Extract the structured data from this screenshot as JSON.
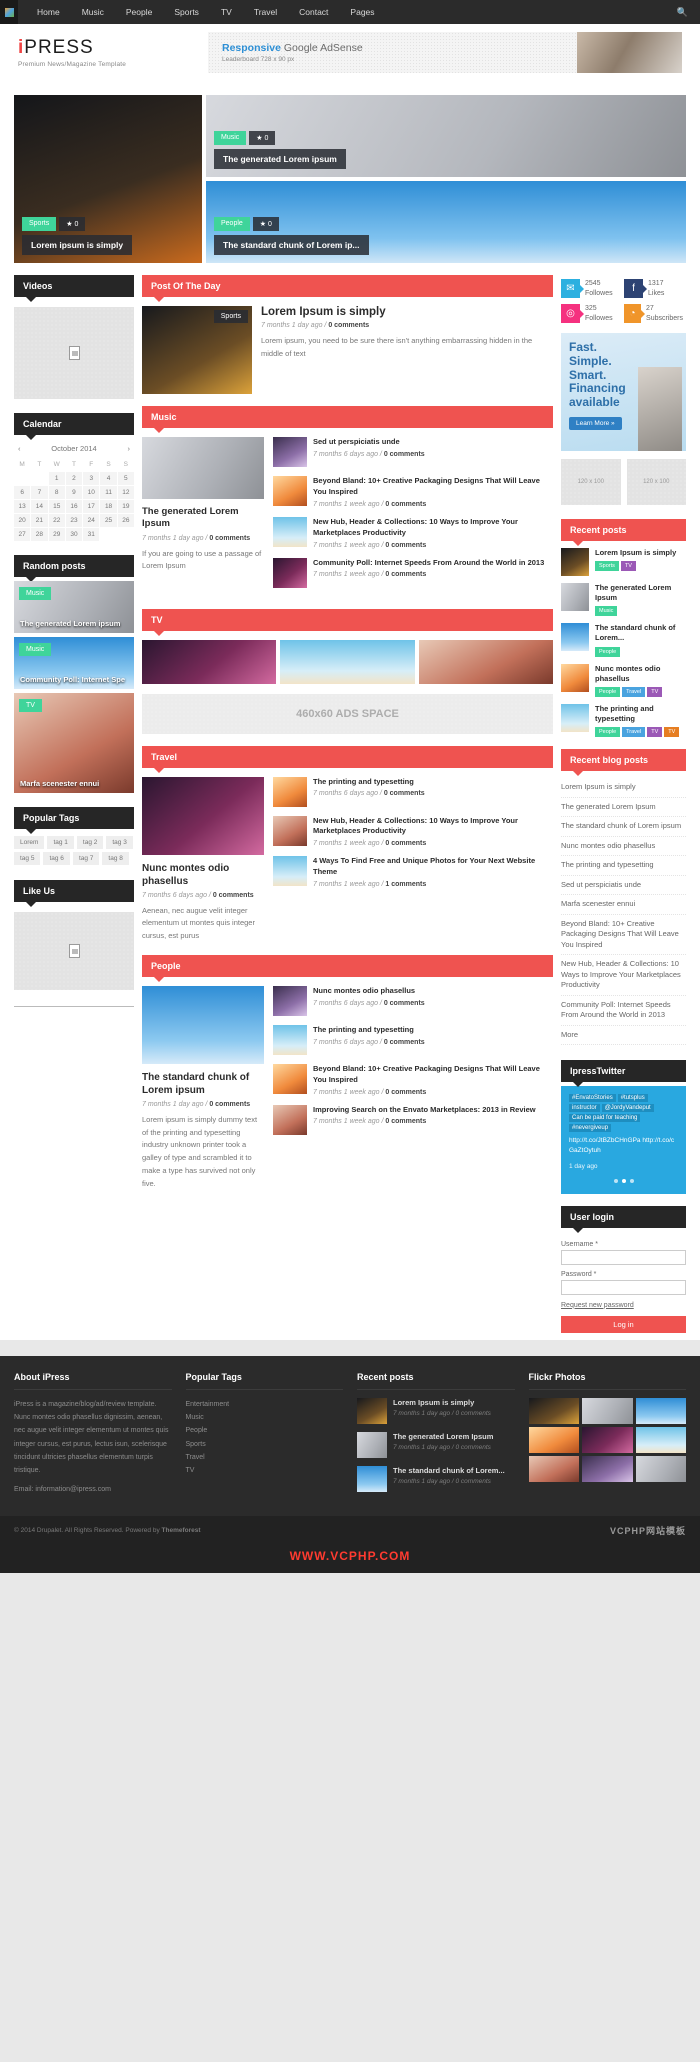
{
  "topnav": {
    "items": [
      "Home",
      "Music",
      "People",
      "Sports",
      "TV",
      "Travel",
      "Contact",
      "Pages"
    ],
    "search_icon": "search-icon"
  },
  "header": {
    "logo_i": "i",
    "logo_rest": "PRESS",
    "tagline": "Premium News/Magazine Template",
    "ad_line1_bold": "Responsive",
    "ad_line1_rest": " Google AdSense",
    "ad_line2": "Leaderboard 728 x 90 px"
  },
  "slider": {
    "big": {
      "category": "Sports",
      "stars": "0",
      "title": "Lorem ipsum is simply"
    },
    "small1": {
      "category": "Music",
      "stars": "0",
      "title": "The generated Lorem ipsum"
    },
    "small2": {
      "category": "People",
      "stars": "0",
      "title": "The standard chunk of Lorem ip..."
    }
  },
  "left": {
    "videos_title": "Videos",
    "calendar_title": "Calendar",
    "calendar": {
      "prev": "‹",
      "next": "›",
      "month": "October 2014",
      "weekdays": [
        "M",
        "T",
        "W",
        "T",
        "F",
        "S",
        "S"
      ],
      "lead_blanks": 2,
      "days": [
        1,
        2,
        3,
        4,
        5,
        6,
        7,
        8,
        9,
        10,
        11,
        12,
        13,
        14,
        15,
        16,
        17,
        18,
        19,
        20,
        21,
        22,
        23,
        24,
        25,
        26,
        27,
        28,
        29,
        30,
        31
      ]
    },
    "random_title": "Random posts",
    "random": [
      {
        "tag": "Music",
        "title": "The generated Lorem ipsum"
      },
      {
        "tag": "Music",
        "title": "Community Poll: Internet Spe"
      },
      {
        "tag": "TV",
        "title": "Marfa scenester ennui"
      }
    ],
    "tags_title": "Popular Tags",
    "tags": [
      "Lorem",
      "tag 1",
      "tag 2",
      "tag 3",
      "tag 5",
      "tag 6",
      "tag 7",
      "tag 8"
    ],
    "like_title": "Like Us"
  },
  "mid": {
    "pod_title": "Post Of The Day",
    "pod": {
      "badge": "Sports",
      "title": "Lorem Ipsum is simply",
      "meta": "7 months 1 day ago / ",
      "meta_b": "0 comments",
      "excerpt": "Lorem ipsum, you need to be sure there isn't anything embarrassing hidden in the middle of text"
    },
    "music_title": "Music",
    "music_main": {
      "title": "The generated Lorem Ipsum",
      "meta": "7 months 1 day ago / ",
      "meta_b": "0 comments",
      "excerpt": "If you are going to use a passage of Lorem Ipsum"
    },
    "music_list": [
      {
        "title": "Sed ut perspiciatis unde",
        "meta": "7 months 6 days ago / ",
        "meta_b": "0 comments"
      },
      {
        "title": "Beyond Bland: 10+ Creative Packaging Designs That Will Leave You Inspired",
        "meta": "7 months 1 week ago / ",
        "meta_b": "0 comments"
      },
      {
        "title": "New Hub, Header & Collections: 10 Ways to Improve Your Marketplaces Productivity",
        "meta": "7 months 1 week ago / ",
        "meta_b": "0 comments"
      },
      {
        "title": "Community Poll: Internet Speeds From Around the World in 2013",
        "meta": "7 months 1 week ago / ",
        "meta_b": "0 comments"
      }
    ],
    "tv_title": "TV",
    "ads_label": "460x60 ADS SPACE",
    "travel_title": "Travel",
    "travel_main": {
      "title": "Nunc montes odio phasellus",
      "meta": "7 months 6 days ago / ",
      "meta_b": "0 comments",
      "excerpt": "Aenean, nec augue velit integer elementum ut montes quis integer cursus, est purus"
    },
    "travel_list": [
      {
        "title": "The printing and typesetting",
        "meta": "7 months 6 days ago / ",
        "meta_b": "0 comments"
      },
      {
        "title": "New Hub, Header & Collections: 10 Ways to Improve Your Marketplaces Productivity",
        "meta": "7 months 1 week ago / ",
        "meta_b": "0 comments"
      },
      {
        "title": "4 Ways To Find Free and Unique Photos for Your Next Website Theme",
        "meta": "7 months 1 week ago / ",
        "meta_b": "1 comments"
      }
    ],
    "people_title": "People",
    "people_main": {
      "title": "The standard chunk of Lorem ipsum",
      "meta": "7 months 1 day ago / ",
      "meta_b": "0 comments",
      "excerpt": "Lorem ipsum is simply dummy text of the printing and typesetting industry unknown printer took a galley of type and scrambled it to make a type has survived not only five."
    },
    "people_list": [
      {
        "title": "Nunc montes odio phasellus",
        "meta": "7 months 6 days ago / ",
        "meta_b": "0 comments"
      },
      {
        "title": "The printing and typesetting",
        "meta": "7 months 6 days ago / ",
        "meta_b": "0 comments"
      },
      {
        "title": "Beyond Bland: 10+ Creative Packaging Designs That Will Leave You Inspired",
        "meta": "7 months 1 week ago / ",
        "meta_b": "0 comments"
      },
      {
        "title": "Improving Search on the Envato Marketplaces: 2013 in Review",
        "meta": "7 months 1 week ago / ",
        "meta_b": "0 comments"
      }
    ]
  },
  "right": {
    "social": [
      {
        "icon": "twitter-icon",
        "count": "2545",
        "label": "Followes",
        "color": "#2cb0e0"
      },
      {
        "icon": "facebook-icon",
        "count": "1317",
        "label": "Likes",
        "color": "#2d4373"
      },
      {
        "icon": "dribbble-icon",
        "count": "325",
        "label": "Followes",
        "color": "#f5317f"
      },
      {
        "icon": "rss-icon",
        "count": "27",
        "label": "Subscribers",
        "color": "#f0952a"
      }
    ],
    "banner": {
      "l1": "Fast.",
      "l2": "Simple.",
      "l3": "Smart.",
      "l4": "Financing",
      "l5": "available",
      "cta": "Learn More »"
    },
    "placeholders": [
      "120 x 100",
      "120 x 100"
    ],
    "recent_title": "Recent posts",
    "recent": [
      {
        "title": "Lorem Ipsum is simply",
        "tags": [
          {
            "t": "Sports",
            "c": "#3fd49a"
          },
          {
            "t": "TV",
            "c": "#9b59b6"
          }
        ]
      },
      {
        "title": "The generated Lorem Ipsum",
        "tags": [
          {
            "t": "Music",
            "c": "#3fd49a"
          }
        ]
      },
      {
        "title": "The standard chunk of Lorem...",
        "tags": [
          {
            "t": "People",
            "c": "#3fd49a"
          }
        ]
      },
      {
        "title": "Nunc montes odio phasellus",
        "tags": [
          {
            "t": "People",
            "c": "#3fd49a"
          },
          {
            "t": "Travel",
            "c": "#4aa3df"
          },
          {
            "t": "TV",
            "c": "#9b59b6"
          }
        ]
      },
      {
        "title": "The printing and typesetting",
        "tags": [
          {
            "t": "People",
            "c": "#3fd49a"
          },
          {
            "t": "Travel",
            "c": "#4aa3df"
          },
          {
            "t": "TV",
            "c": "#9b59b6"
          },
          {
            "t": "TV",
            "c": "#e67e22"
          }
        ]
      }
    ],
    "blog_title": "Recent blog posts",
    "blog": [
      "Lorem Ipsum is simply",
      "The generated Lorem Ipsum",
      "The standard chunk of Lorem ipsum",
      "Nunc montes odio phasellus",
      "The printing and typesetting",
      "Sed ut perspiciatis unde",
      "Marfa scenester ennui",
      "Beyond Bland: 10+ Creative Packaging Designs That Will Leave You Inspired",
      "New Hub, Header & Collections: 10 Ways to Improve Your Marketplaces Productivity",
      "Community Poll: Internet Speeds From Around the World in 2013",
      "More"
    ],
    "twitter_title": "IpressTwitter",
    "tweet": {
      "hashtags": [
        "#EnvatoStories",
        "#tutsplus",
        "instructor",
        "@JordyVandeput",
        "Can be paid for teaching",
        "#nevergiveup"
      ],
      "links": "http://t.co/JtBZbCHnGPa http://t.co/cGaZtOytuh",
      "ago": "1 day ago"
    },
    "login_title": "User login",
    "login": {
      "user_label": "Username *",
      "pass_label": "Password *",
      "request": "Request new password",
      "button": "Log in"
    }
  },
  "footer": {
    "about_title": "About iPress",
    "about_text": "iPress is a magazine/blog/ad/review template. Nunc montes odio phasellus dignissim, aenean, nec augue velit integer elementum ut montes quis integer cursus, est purus, lectus isun, scelerisque tincidunt ultricies phasellus elementum turpis tristique.",
    "email": "Email: information@ipress.com",
    "tags_title": "Popular Tags",
    "tags": [
      "Entertainment",
      "Music",
      "People",
      "Sports",
      "Travel",
      "TV"
    ],
    "recent_title": "Recent posts",
    "recent": [
      {
        "title": "Lorem Ipsum is simply",
        "meta": "7 months 1 day ago / 0 comments"
      },
      {
        "title": "The generated Lorem Ipsum",
        "meta": "7 months 1 day ago / 0 comments"
      },
      {
        "title": "The standard chunk of Lorem...",
        "meta": "7 months 1 day ago / 0 comments"
      }
    ],
    "flickr_title": "Flickr Photos",
    "copyright": "© 2014 Drupalet. All Rights Reserved. Powered by ",
    "powered": "Themeforest",
    "watermark": "VCPHP网站模板",
    "site": "WWW.VCPHP.COM"
  }
}
